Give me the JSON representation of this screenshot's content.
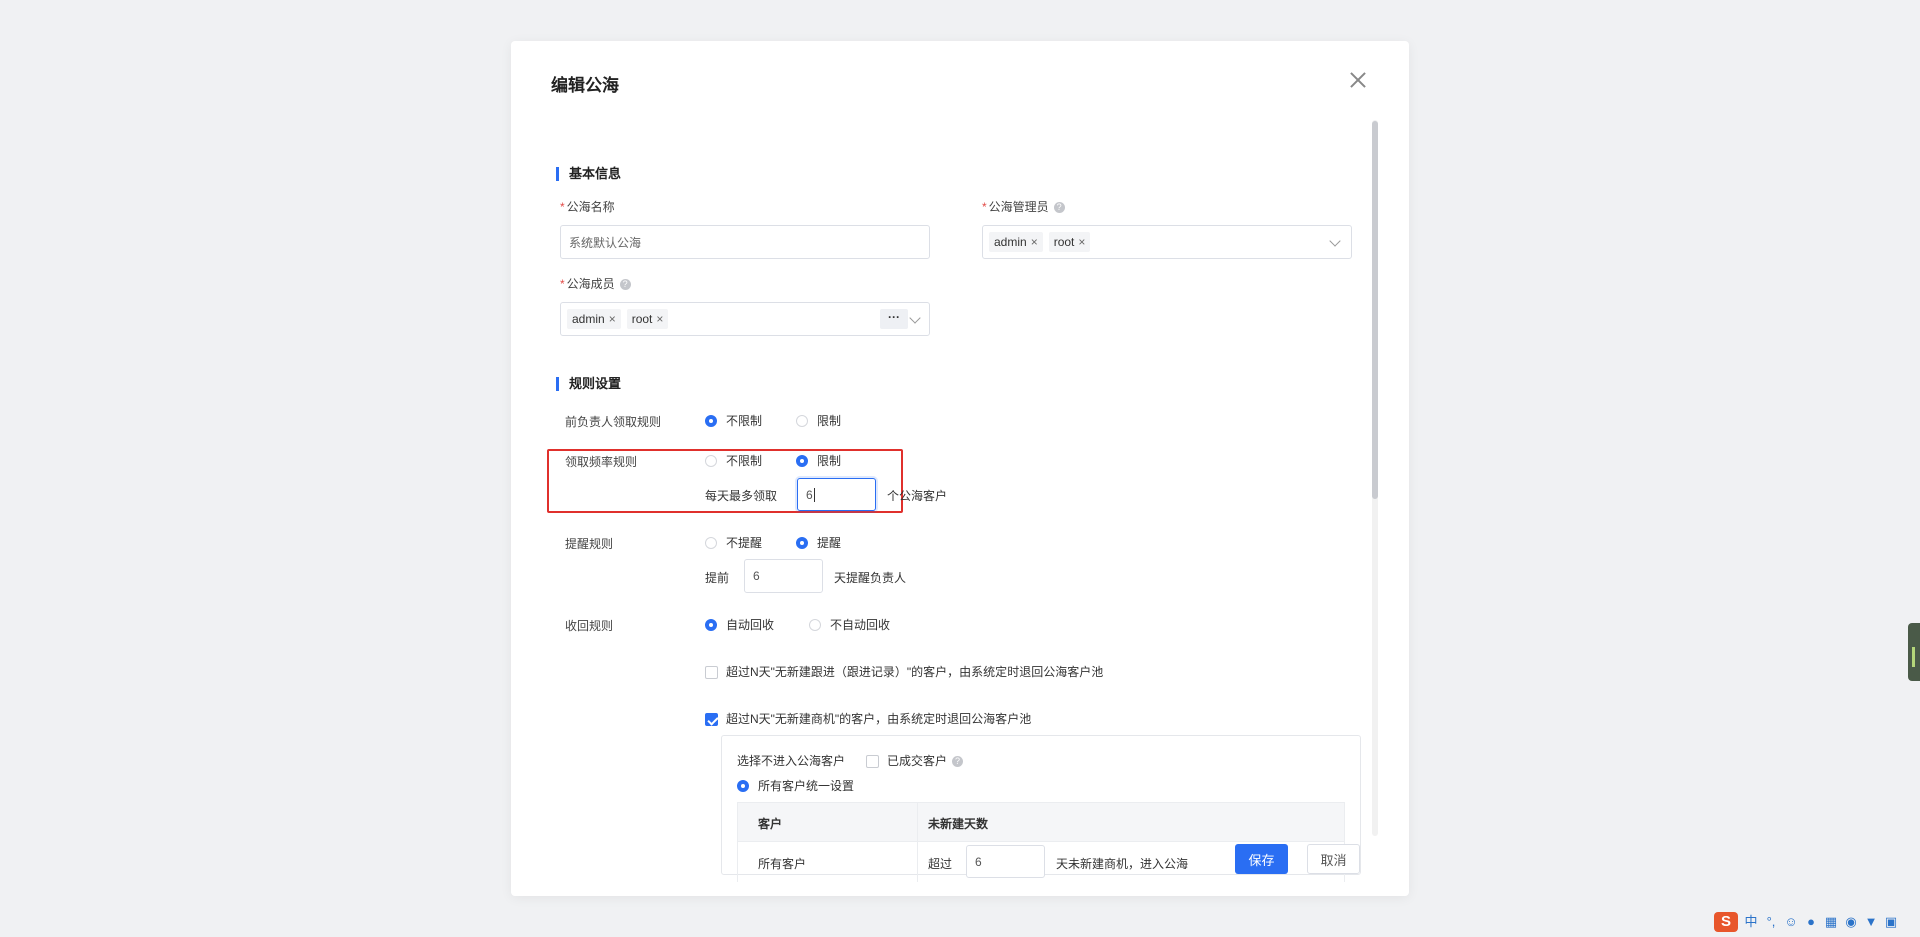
{
  "dialog": {
    "title": "编辑公海",
    "save_label": "保存",
    "cancel_label": "取消"
  },
  "basic": {
    "section_title": "基本信息",
    "name_label": "公海名称",
    "name_placeholder": "系统默认公海",
    "admins_label": "公海管理员",
    "admins": [
      "admin",
      "root"
    ],
    "members_label": "公海成员",
    "members": [
      "admin",
      "root"
    ],
    "more": "···",
    "required_mark": "*",
    "help_mark": "?",
    "tag_close": "×"
  },
  "rules": {
    "section_title": "规则设置",
    "prev_owner": {
      "label": "前负责人领取规则",
      "opt1": "不限制",
      "opt2": "限制",
      "selected": "不限制"
    },
    "frequency": {
      "label": "领取频率规则",
      "opt1": "不限制",
      "opt2": "限制",
      "selected": "限制",
      "prefix": "每天最多领取",
      "value": "6",
      "suffix": "个公海客户"
    },
    "reminder": {
      "label": "提醒规则",
      "opt1": "不提醒",
      "opt2": "提醒",
      "selected": "提醒",
      "prefix": "提前",
      "value": "6",
      "suffix": "天提醒负责人"
    },
    "recycle": {
      "label": "收回规则",
      "opt1": "自动回收",
      "opt2": "不自动回收",
      "selected": "自动回收",
      "check1": {
        "text": "超过N天\"无新建跟进（跟进记录）\"的客户，由系统定时退回公海客户池",
        "checked": false
      },
      "check2": {
        "text": "超过N天\"无新建商机\"的客户，由系统定时退回公海客户池",
        "checked": true
      },
      "exclude_label": "选择不进入公海客户",
      "exclude_option": "已成交客户",
      "unified_option": "所有客户统一设置",
      "table": {
        "headers": [
          "客户",
          "未新建天数"
        ],
        "rows": [
          {
            "customer": "所有客户",
            "prefix": "超过",
            "value": "6",
            "suffix": "天未新建商机，进入公海"
          }
        ]
      }
    }
  },
  "taskbar": {
    "ime_logo": "S",
    "ime_lang": "中",
    "ime_punct": "°,"
  },
  "colors": {
    "primary": "#2a6ef3",
    "highlight": "#e0302c"
  }
}
